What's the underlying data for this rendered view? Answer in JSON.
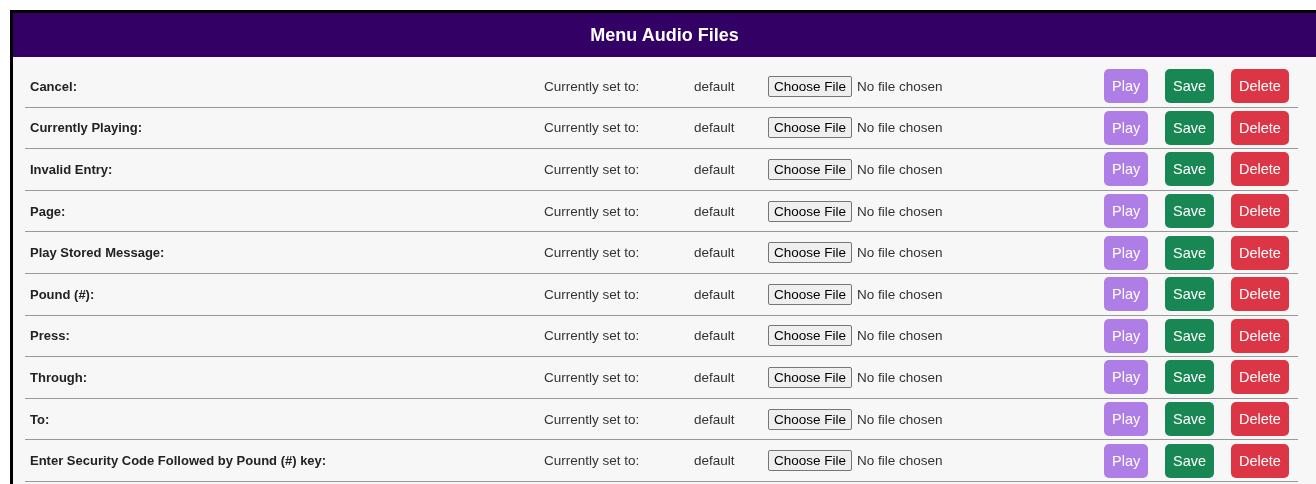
{
  "panel": {
    "title": "Menu Audio Files"
  },
  "rows": [
    {
      "label": "Cancel:",
      "status_label": "Currently set to:",
      "value": "default",
      "file_button": "Choose File",
      "file_status": "No file chosen",
      "actions": [
        {
          "kind": "play",
          "label": "Play"
        },
        {
          "kind": "save",
          "label": "Save"
        },
        {
          "kind": "delete",
          "label": "Delete"
        }
      ]
    },
    {
      "label": "Currently Playing:",
      "status_label": "Currently set to:",
      "value": "default",
      "file_button": "Choose File",
      "file_status": "No file chosen",
      "actions": [
        {
          "kind": "play",
          "label": "Play"
        },
        {
          "kind": "save",
          "label": "Save"
        },
        {
          "kind": "delete",
          "label": "Delete"
        }
      ]
    },
    {
      "label": "Invalid Entry:",
      "status_label": "Currently set to:",
      "value": "default",
      "file_button": "Choose File",
      "file_status": "No file chosen",
      "actions": [
        {
          "kind": "play",
          "label": "Play"
        },
        {
          "kind": "save",
          "label": "Save"
        },
        {
          "kind": "delete",
          "label": "Delete"
        }
      ]
    },
    {
      "label": "Page:",
      "status_label": "Currently set to:",
      "value": "default",
      "file_button": "Choose File",
      "file_status": "No file chosen",
      "actions": [
        {
          "kind": "play",
          "label": "Play"
        },
        {
          "kind": "save",
          "label": "Save"
        },
        {
          "kind": "delete",
          "label": "Delete"
        }
      ]
    },
    {
      "label": "Play Stored Message:",
      "status_label": "Currently set to:",
      "value": "default",
      "file_button": "Choose File",
      "file_status": "No file chosen",
      "actions": [
        {
          "kind": "play",
          "label": "Play"
        },
        {
          "kind": "save",
          "label": "Save"
        },
        {
          "kind": "delete",
          "label": "Delete"
        }
      ]
    },
    {
      "label": "Pound (#):",
      "status_label": "Currently set to:",
      "value": "default",
      "file_button": "Choose File",
      "file_status": "No file chosen",
      "actions": [
        {
          "kind": "play",
          "label": "Play"
        },
        {
          "kind": "save",
          "label": "Save"
        },
        {
          "kind": "delete",
          "label": "Delete"
        }
      ]
    },
    {
      "label": "Press:",
      "status_label": "Currently set to:",
      "value": "default",
      "file_button": "Choose File",
      "file_status": "No file chosen",
      "actions": [
        {
          "kind": "play",
          "label": "Play"
        },
        {
          "kind": "save",
          "label": "Save"
        },
        {
          "kind": "delete",
          "label": "Delete"
        }
      ]
    },
    {
      "label": "Through:",
      "status_label": "Currently set to:",
      "value": "default",
      "file_button": "Choose File",
      "file_status": "No file chosen",
      "actions": [
        {
          "kind": "play",
          "label": "Play"
        },
        {
          "kind": "save",
          "label": "Save"
        },
        {
          "kind": "delete",
          "label": "Delete"
        }
      ]
    },
    {
      "label": "To:",
      "status_label": "Currently set to:",
      "value": "default",
      "file_button": "Choose File",
      "file_status": "No file chosen",
      "actions": [
        {
          "kind": "play",
          "label": "Play"
        },
        {
          "kind": "save",
          "label": "Save"
        },
        {
          "kind": "delete",
          "label": "Delete"
        }
      ]
    },
    {
      "label": "Enter Security Code Followed by Pound (#) key:",
      "status_label": "Currently set to:",
      "value": "default",
      "file_button": "Choose File",
      "file_status": "No file chosen",
      "actions": [
        {
          "kind": "play",
          "label": "Play"
        },
        {
          "kind": "save",
          "label": "Save"
        },
        {
          "kind": "delete",
          "label": "Delete"
        }
      ]
    }
  ]
}
